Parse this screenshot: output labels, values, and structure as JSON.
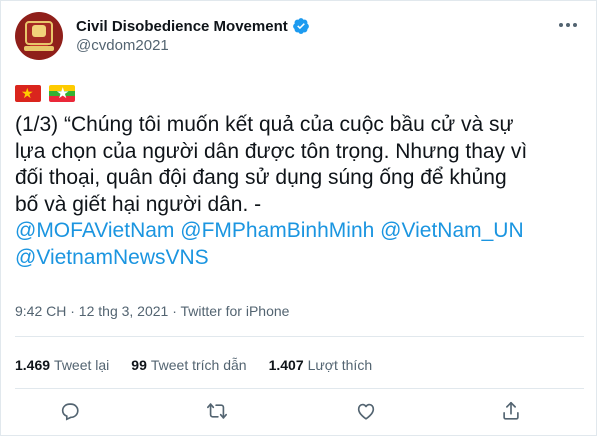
{
  "account": {
    "name": "Civil Disobedience Movement",
    "handle": "@cvdom2021"
  },
  "icons": {
    "verified": "verified-badge-icon",
    "more": "more-options-icon",
    "reply": "reply-icon",
    "retweet": "retweet-icon",
    "like": "heart-icon",
    "share": "share-icon"
  },
  "flags": [
    "vietnam-flag",
    "myanmar-flag"
  ],
  "tweet": {
    "lines": [
      "(1/3) “Chúng tôi muốn kết quả của cuộc bầu cử và sự",
      "lựa chọn của người dân được tôn trọng. Nhưng thay vì",
      "đối thoại, quân đội đang sử dụng súng ống để khủng",
      "bố và giết hại người dân. -"
    ],
    "mentions_line1": [
      "@MOFAVietNam",
      "@FMPhamBinhMinh",
      "@VietNam_UN"
    ],
    "mentions_line2": [
      "@VietnamNewsVNS"
    ]
  },
  "meta": "9:42 CH · 12 thg 3, 2021 · Twitter for iPhone",
  "stats": {
    "retweets": {
      "count": "1.469",
      "label": "Tweet lại"
    },
    "quotes": {
      "count": "99",
      "label": "Tweet trích dẫn"
    },
    "likes": {
      "count": "1.407",
      "label": "Lượt thích"
    }
  },
  "colors": {
    "link": "#1b95e0",
    "verified": "#1d9bf0",
    "secondary_text": "#536471",
    "divider": "#e1e8ed"
  }
}
